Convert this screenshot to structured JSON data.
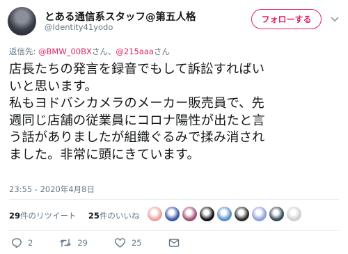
{
  "user": {
    "name": "とある通信系スタッフ@第五人格",
    "handle": "@Identity41yodo"
  },
  "follow_button": {
    "label": "フォローする"
  },
  "reply": {
    "prefix": "返信先: ",
    "mentions": [
      "@BMW_00BX",
      "@215aaa"
    ],
    "honorific": "さん",
    "separator": "、"
  },
  "tweet": {
    "text": "店長たちの発言を録音でもして訴訟すればい\nいと思います。\n私もヨドバシカメラのメーカー販売員で、先\n週同じ店舗の従業員にコロナ陽性が出たと言\nう話がありましたが組織ぐるみで揉み消され\nました。非常に頭にきています。",
    "timestamp": "23:55 - 2020年4月8日"
  },
  "stats": {
    "retweets_count": "29",
    "retweets_label": "件のリツイート",
    "likes_count": "25",
    "likes_label": "件のいいね"
  },
  "liker_avatars": [
    "#e9a3a0",
    "#3a5aa8",
    "#a0507a",
    "#111111",
    "#5a8fc9",
    "#2a2a2a",
    "#8ea0d8",
    "#354a5c",
    "#cfcfcf"
  ],
  "actions": {
    "reply_count": "2",
    "retweet_count": "29",
    "like_count": "25"
  },
  "colors": {
    "accent": "#e0245e",
    "muted": "#657786",
    "text": "#14171a"
  }
}
